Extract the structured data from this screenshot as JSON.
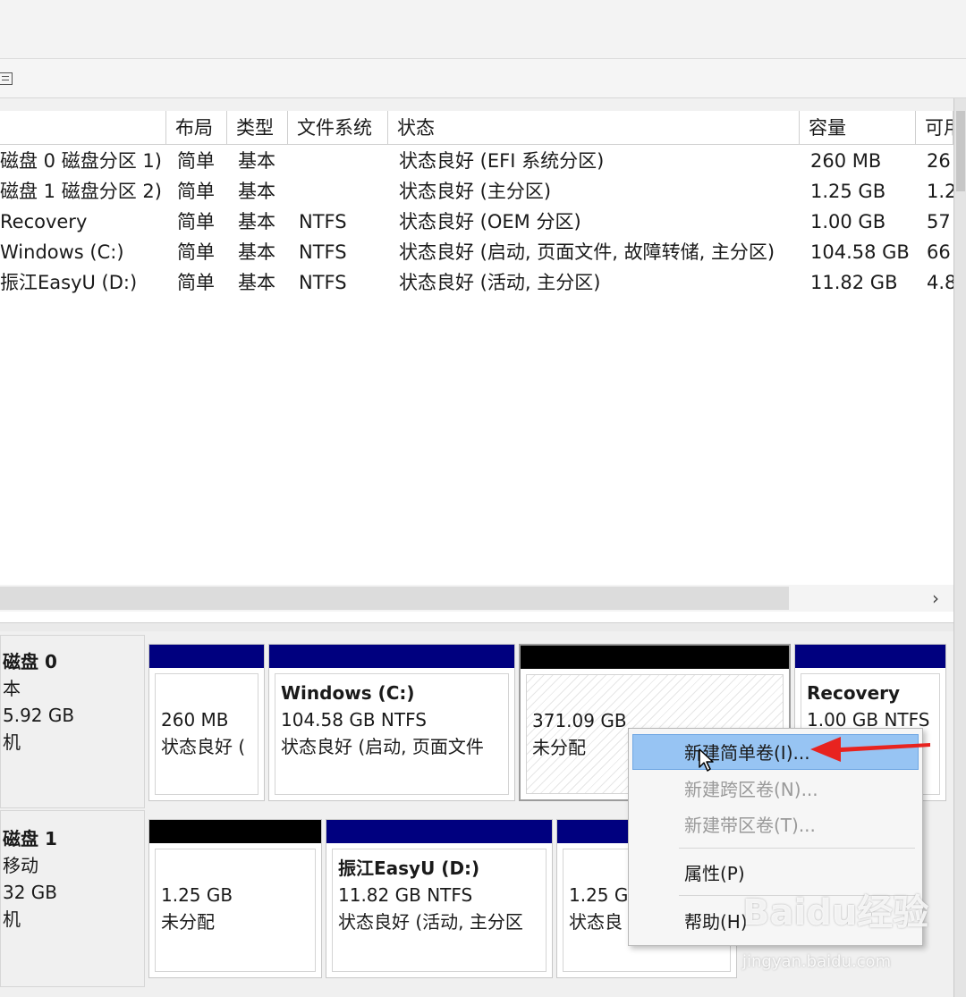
{
  "table": {
    "columns": [
      "",
      "布局",
      "类型",
      "文件系统",
      "状态",
      "容量",
      "可用"
    ],
    "rows": [
      {
        "volume": "磁盘 0 磁盘分区 1)",
        "layout": "简单",
        "type": "基本",
        "fs": "",
        "status": "状态良好 (EFI 系统分区)",
        "capacity": "260 MB",
        "free": "26"
      },
      {
        "volume": "磁盘 1 磁盘分区 2)",
        "layout": "简单",
        "type": "基本",
        "fs": "",
        "status": "状态良好 (主分区)",
        "capacity": "1.25 GB",
        "free": "1.2"
      },
      {
        "volume": "Recovery",
        "layout": "简单",
        "type": "基本",
        "fs": "NTFS",
        "status": "状态良好 (OEM 分区)",
        "capacity": "1.00 GB",
        "free": "57"
      },
      {
        "volume": "Windows (C:)",
        "layout": "简单",
        "type": "基本",
        "fs": "NTFS",
        "status": "状态良好 (启动, 页面文件, 故障转储, 主分区)",
        "capacity": "104.58 GB",
        "free": "66"
      },
      {
        "volume": "振江EasyU (D:)",
        "layout": "简单",
        "type": "基本",
        "fs": "NTFS",
        "status": "状态良好 (活动, 主分区)",
        "capacity": "11.82 GB",
        "free": "4.8"
      }
    ]
  },
  "scroll_arrow": "›",
  "disks": [
    {
      "name": "磁盘 0",
      "kind": "本",
      "size": "5.92 GB",
      "state": "机",
      "volumes": [
        {
          "name": "",
          "size": "260 MB",
          "status": "状态良好 ("
        },
        {
          "name": "Windows  (C:)",
          "size": "104.58 GB NTFS",
          "status": "状态良好 (启动, 页面文件"
        },
        {
          "name": "",
          "size": "371.09 GB",
          "status": "未分配"
        },
        {
          "name": "Recovery",
          "size": "1.00 GB NTFS",
          "status": ""
        }
      ]
    },
    {
      "name": "磁盘 1",
      "kind": "移动",
      "size": "32 GB",
      "state": "机",
      "volumes": [
        {
          "name": "",
          "size": "1.25 GB",
          "status": "未分配"
        },
        {
          "name": "振江EasyU  (D:)",
          "size": "11.82 GB NTFS",
          "status": "状态良好 (活动, 主分区"
        },
        {
          "name": "",
          "size": "1.25 G",
          "status": "状态良"
        }
      ]
    }
  ],
  "context_menu": {
    "items": [
      {
        "label": "新建简单卷(I)...",
        "state": "highlighted"
      },
      {
        "label": "新建跨区卷(N)...",
        "state": "disabled"
      },
      {
        "label": "新建带区卷(T)...",
        "state": "disabled"
      },
      {
        "label": "属性(P)",
        "state": "enabled"
      },
      {
        "label": "帮助(H)",
        "state": "enabled"
      }
    ]
  },
  "watermark": {
    "logo": "Baidu经验",
    "url": "jingyan.baidu.com"
  },
  "colors": {
    "volume_bar_primary": "#00007f",
    "volume_bar_unallocated": "#000000",
    "menu_highlight": "#97c4f3",
    "annotation_arrow": "#e8231f"
  }
}
